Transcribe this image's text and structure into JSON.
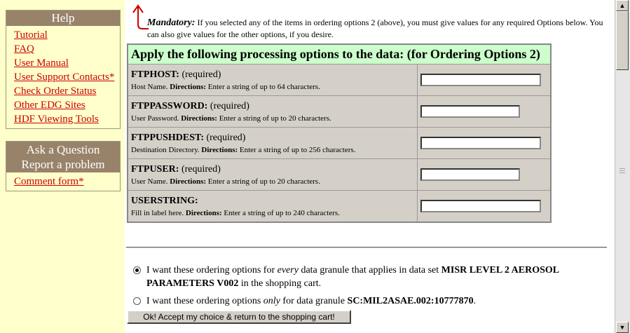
{
  "help": {
    "title": "Help",
    "links": [
      "Tutorial",
      "FAQ",
      "User Manual",
      "User Support Contacts*",
      "Check Order Status",
      "Other EDG Sites",
      "HDF Viewing Tools"
    ]
  },
  "ask": {
    "title_line1": "Ask a Question",
    "title_line2": "Report a problem",
    "links": [
      "Comment form*"
    ]
  },
  "mandatory": {
    "label": "Mandatory:",
    "text": "If you selected any of the items in ordering options 2 (above), you must give values for any required Options below. You can also give values for the other options, if you desire."
  },
  "options_table": {
    "title": "Apply the following processing options to the data: (for Ordering Options 2)",
    "rows": [
      {
        "name": "FTPHOST:",
        "req": "(required)",
        "desc": "Host Name.",
        "dir_label": "Directions:",
        "dir": "Enter a string of up to 64 characters.",
        "value": ""
      },
      {
        "name": "FTPPASSWORD:",
        "req": "(required)",
        "desc": "User Password.",
        "dir_label": "Directions:",
        "dir": "Enter a string of up to 20 characters.",
        "value": ""
      },
      {
        "name": "FTPPUSHDEST:",
        "req": "(required)",
        "desc": "Destination Directory.",
        "dir_label": "Directions:",
        "dir": "Enter a string of up to 256 characters.",
        "value": ""
      },
      {
        "name": "FTPUSER:",
        "req": "(required)",
        "desc": "User Name.",
        "dir_label": "Directions:",
        "dir": "Enter a string of up to 20 characters.",
        "value": ""
      },
      {
        "name": "USERSTRING:",
        "req": "",
        "desc": "Fill in label here.",
        "dir_label": "Directions:",
        "dir": "Enter a string of up to 240 characters.",
        "value": ""
      }
    ]
  },
  "choice": {
    "opt1_pre": "I want these ordering options for",
    "opt1_em": "every",
    "opt1_mid": "data granule that applies in data set",
    "opt1_bold": "MISR LEVEL 2 AEROSOL PARAMETERS V002",
    "opt1_post": "in the shopping cart.",
    "opt2_pre": "I want these ordering options",
    "opt2_em": "only",
    "opt2_mid": "for data granule",
    "opt2_bold": "SC:MIL2ASAE.002:10777870",
    "opt2_post": ".",
    "selected": 1
  },
  "ok_button": "Ok! Accept my choice & return to the shopping cart!"
}
